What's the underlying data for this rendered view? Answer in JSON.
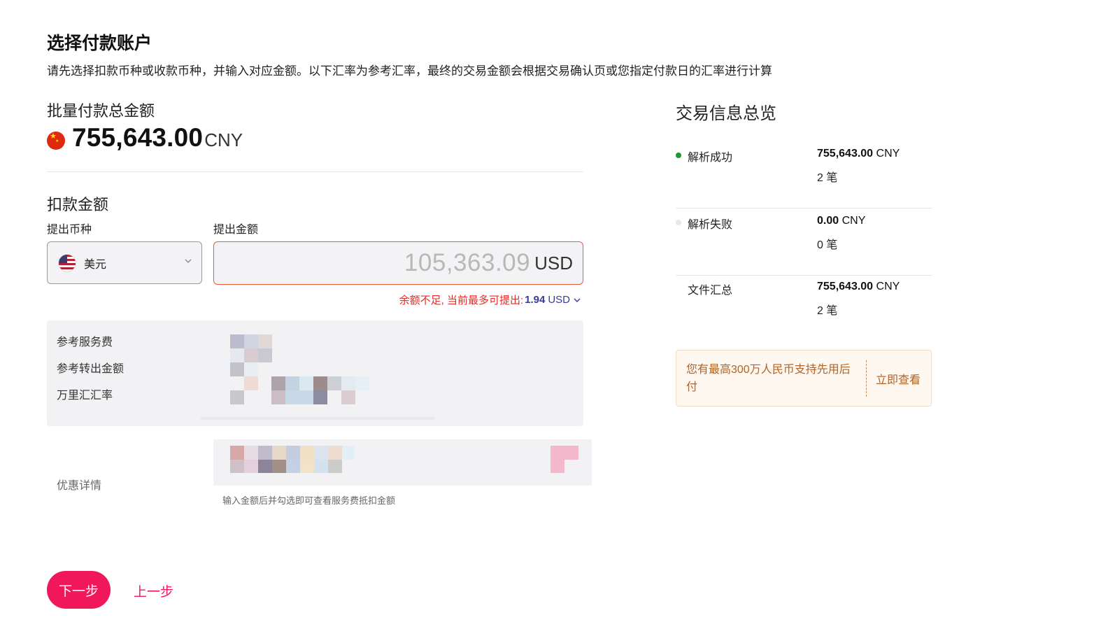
{
  "header": {
    "title": "选择付款账户",
    "description": "请先选择扣款币种或收款币种，并输入对应金额。以下汇率为参考汇率，最终的交易金额会根据交易确认页或您指定付款日的汇率进行计算"
  },
  "total": {
    "label": "批量付款总金额",
    "amount": "755,643.00",
    "currency": "CNY"
  },
  "debit": {
    "section_title": "扣款金额",
    "currency_label": "提出币种",
    "amount_label": "提出金额",
    "currency_value": "美元",
    "amount_value": "105,363.09",
    "amount_currency": "USD",
    "warning_text": "余额不足, 当前最多可提出:",
    "max_amount": "1.94",
    "max_currency": "USD"
  },
  "fees": {
    "service_fee_label": "参考服务费",
    "transfer_amount_label": "参考转出金额",
    "rate_label": "万里汇汇率"
  },
  "discount": {
    "label": "优惠详情",
    "hint": "输入金额后并勾选即可查看服务费抵扣金额"
  },
  "actions": {
    "next": "下一步",
    "prev": "上一步"
  },
  "summary": {
    "title": "交易信息总览",
    "rows": [
      {
        "label": "解析成功",
        "amount": "755,643.00",
        "currency": "CNY",
        "count": "2 笔",
        "dot_color": "#1a9a2e"
      },
      {
        "label": "解析失败",
        "amount": "0.00",
        "currency": "CNY",
        "count": "0 笔",
        "dot_color": "#e8e8ea"
      },
      {
        "label": "文件汇总",
        "amount": "755,643.00",
        "currency": "CNY",
        "count": "2 笔"
      }
    ]
  },
  "promo": {
    "text": "您有最高300万人民币支持先用后付",
    "link": "立即查看"
  },
  "colors": {
    "primary": "#f0185a",
    "error": "#e52a2a",
    "promo_text": "#b06428"
  }
}
